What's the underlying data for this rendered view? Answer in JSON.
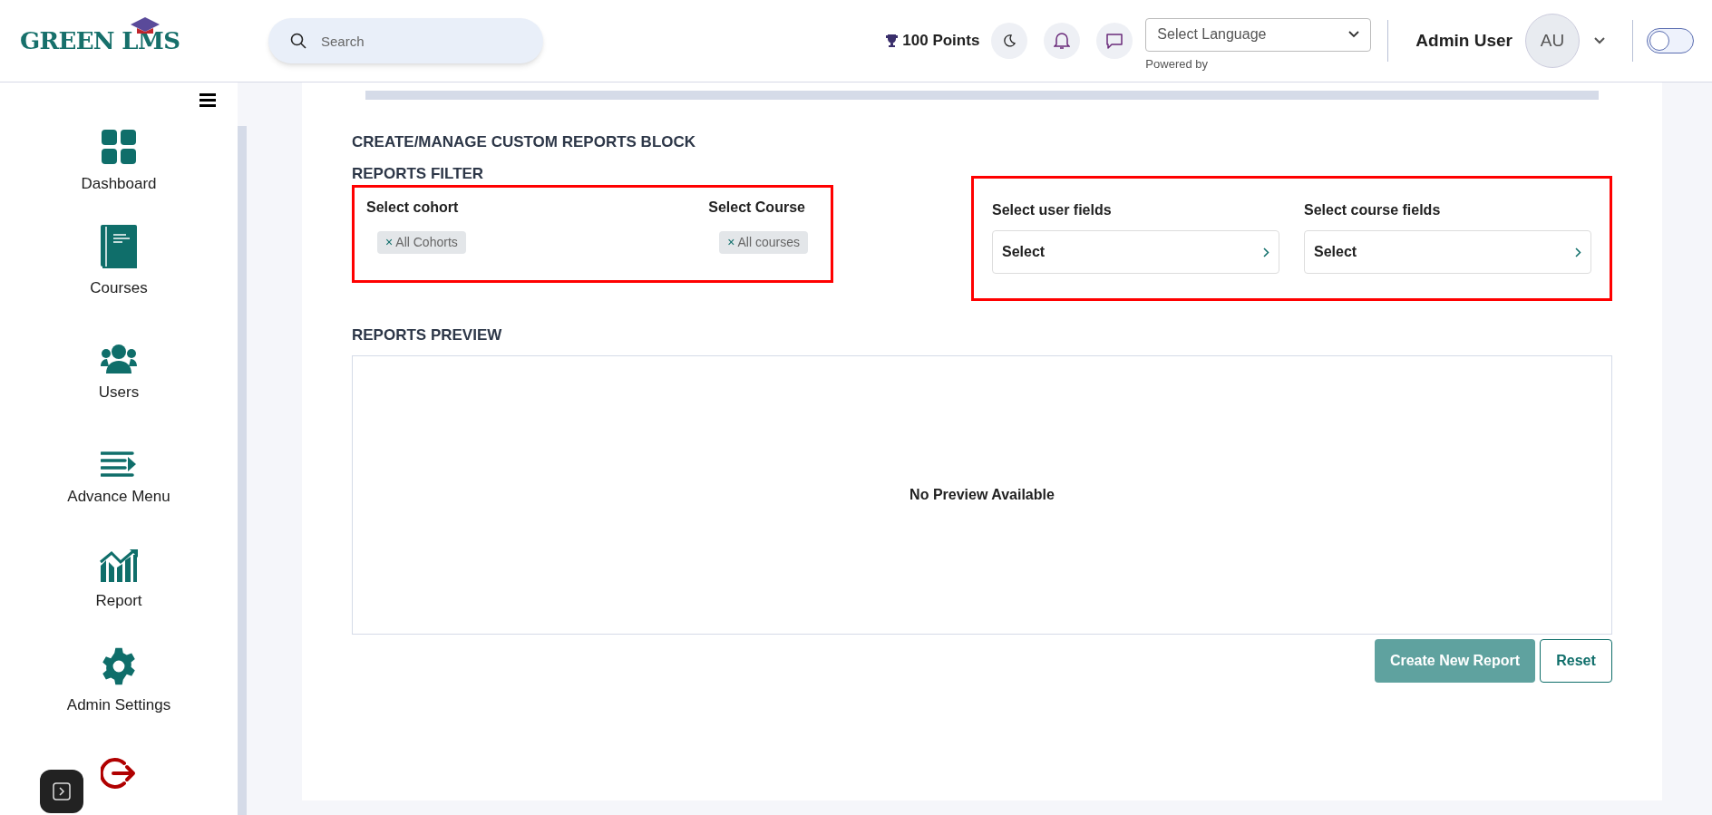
{
  "header": {
    "logo": "GREEN LMS",
    "search": {
      "placeholder": "Search"
    },
    "points": "100 Points",
    "language": {
      "value": "Select Language",
      "note": "Powered by"
    },
    "user": {
      "name": "Admin User",
      "initials": "AU"
    },
    "toggle": {
      "on": false
    }
  },
  "sidebar": {
    "items": [
      {
        "kind": "dashboard",
        "label": "Dashboard"
      },
      {
        "kind": "courses",
        "label": "Courses"
      },
      {
        "kind": "users",
        "label": "Users"
      },
      {
        "kind": "menu",
        "label": "Advance Menu"
      },
      {
        "kind": "report",
        "label": "Report"
      },
      {
        "kind": "settings",
        "label": "Admin Settings"
      },
      {
        "kind": "logout"
      }
    ]
  },
  "main": {
    "title": "CREATE/MANAGE CUSTOM REPORTS BLOCK",
    "filter_title": "REPORTS FILTER",
    "filters": [
      {
        "label": "Select cohort",
        "remove": "×",
        "tag": "All Cohorts"
      },
      {
        "label": "Select Course",
        "remove": "×",
        "tag": "All courses"
      }
    ],
    "fields": [
      {
        "label": "Select user fields",
        "value": "Select"
      },
      {
        "label": "Select course fields",
        "value": "Select"
      }
    ],
    "preview_title": "REPORTS PREVIEW",
    "preview_text": "No Preview Available",
    "buttons": [
      {
        "kind": "primary",
        "label": "Create New Report"
      },
      {
        "kind": "outline",
        "label": "Reset"
      }
    ]
  }
}
